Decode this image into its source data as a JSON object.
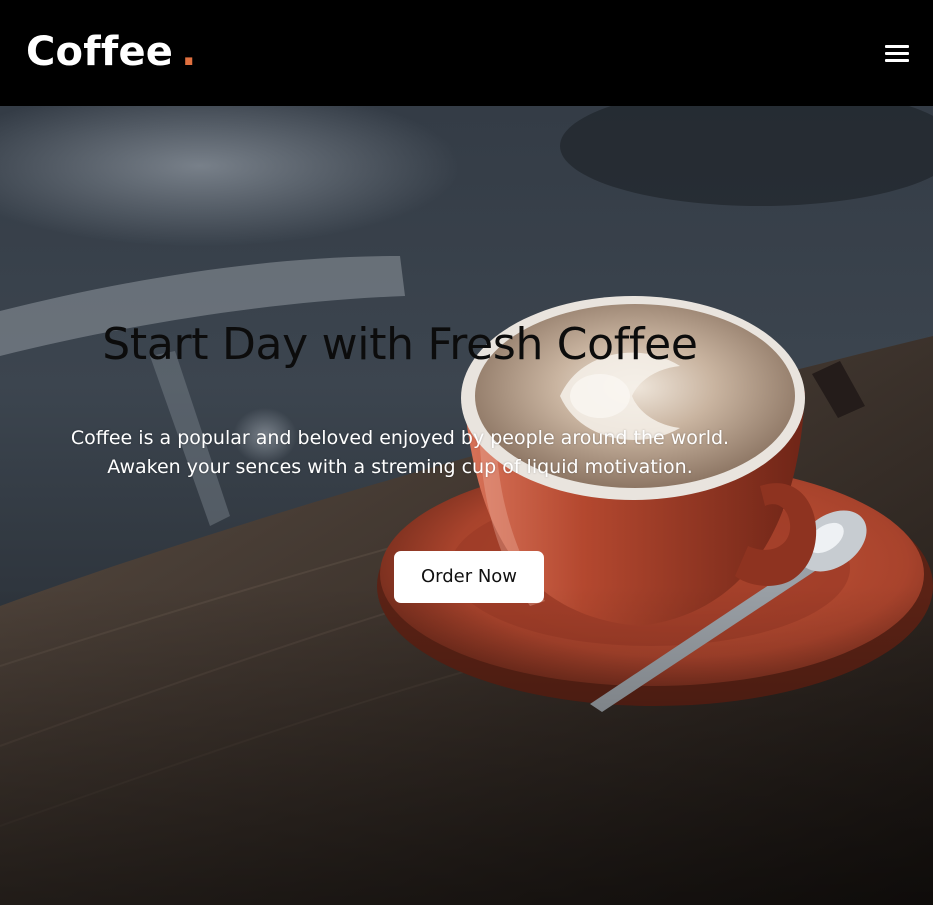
{
  "navbar": {
    "brand_text": "Coffee",
    "brand_dot": ".",
    "menu_icon": "hamburger-menu-icon"
  },
  "hero": {
    "title": "Start Day with Fresh Coffee",
    "subtitle_line1": "Coffee is a popular and beloved enjoyed by people around the world.",
    "subtitle_line2": "Awaken your sences with a streming cup of liquid motivation.",
    "button_label": "Order Now",
    "background_image": "coffee-cup-photo"
  },
  "colors": {
    "navbar_bg": "#000000",
    "brand_text": "#ffffff",
    "brand_accent": "#e0703f",
    "title_text": "#0c0c0c",
    "subtitle_text": "#ffffff",
    "button_bg": "#ffffff",
    "button_text": "#111111"
  }
}
